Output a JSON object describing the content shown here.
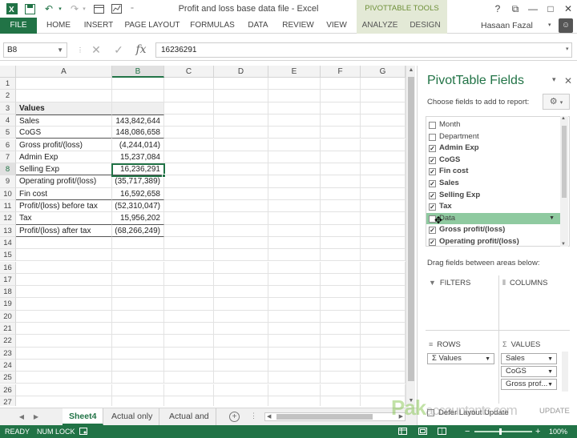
{
  "window": {
    "title": "Profit and loss base data file - Excel",
    "context_tab_group": "PIVOTTABLE TOOLS",
    "controls": [
      "?",
      "⧉",
      "—",
      "□",
      "✕"
    ]
  },
  "ribbon": {
    "tabs": [
      "FILE",
      "HOME",
      "INSERT",
      "PAGE LAYOUT",
      "FORMULAS",
      "DATA",
      "REVIEW",
      "VIEW",
      "ANALYZE",
      "DESIGN"
    ],
    "user": "Hasaan Fazal"
  },
  "formula_bar": {
    "name_box": "B8",
    "formula": "16236291",
    "fx": "fx"
  },
  "grid": {
    "columns": [
      "A",
      "B",
      "C",
      "D",
      "E",
      "F",
      "G"
    ],
    "selected_column": "B",
    "selected_row": 8,
    "rows": [
      {
        "n": "1",
        "a": "",
        "b": ""
      },
      {
        "n": "2",
        "a": "",
        "b": ""
      },
      {
        "n": "3",
        "a": "Values",
        "b": ""
      },
      {
        "n": "4",
        "a": "Sales",
        "b": "143,842,644"
      },
      {
        "n": "5",
        "a": "CoGS",
        "b": "148,086,658"
      },
      {
        "n": "6",
        "a": "Gross profit/(loss)",
        "b": "(4,244,014)"
      },
      {
        "n": "7",
        "a": "Admin Exp",
        "b": "15,237,084"
      },
      {
        "n": "8",
        "a": "Selling Exp",
        "b": "16,236,291"
      },
      {
        "n": "9",
        "a": "Operating profit/(loss)",
        "b": "(35,717,389)"
      },
      {
        "n": "10",
        "a": "Fin cost",
        "b": "16,592,658"
      },
      {
        "n": "11",
        "a": "Profit/(loss) before tax",
        "b": "(52,310,047)"
      },
      {
        "n": "12",
        "a": "Tax",
        "b": "15,956,202"
      },
      {
        "n": "13",
        "a": "Profit/(loss) after tax",
        "b": "(68,266,249)"
      },
      {
        "n": "14",
        "a": "",
        "b": ""
      },
      {
        "n": "15",
        "a": "",
        "b": ""
      },
      {
        "n": "16",
        "a": "",
        "b": ""
      },
      {
        "n": "17",
        "a": "",
        "b": ""
      },
      {
        "n": "18",
        "a": "",
        "b": ""
      },
      {
        "n": "19",
        "a": "",
        "b": ""
      },
      {
        "n": "20",
        "a": "",
        "b": ""
      },
      {
        "n": "21",
        "a": "",
        "b": ""
      },
      {
        "n": "22",
        "a": "",
        "b": ""
      },
      {
        "n": "23",
        "a": "",
        "b": ""
      },
      {
        "n": "24",
        "a": "",
        "b": ""
      },
      {
        "n": "25",
        "a": "",
        "b": ""
      },
      {
        "n": "26",
        "a": "",
        "b": ""
      },
      {
        "n": "27",
        "a": "",
        "b": ""
      }
    ]
  },
  "sheets": {
    "tabs": [
      "Sheet4",
      "Actual only",
      "Actual and"
    ],
    "active": "Sheet4",
    "add": "+"
  },
  "pivot_pane": {
    "title": "PivotTable Fields",
    "choose_label": "Choose fields to add to report:",
    "fields": [
      {
        "label": "Month",
        "checked": false
      },
      {
        "label": "Department",
        "checked": false
      },
      {
        "label": "Admin Exp",
        "checked": true
      },
      {
        "label": "CoGS",
        "checked": true
      },
      {
        "label": "Fin cost",
        "checked": true
      },
      {
        "label": "Sales",
        "checked": true
      },
      {
        "label": "Selling Exp",
        "checked": true
      },
      {
        "label": "Tax",
        "checked": true
      },
      {
        "label": "Data",
        "checked": false,
        "dragging": true
      },
      {
        "label": "Gross profit/(loss)",
        "checked": true
      },
      {
        "label": "Operating profit/(loss)",
        "checked": true
      }
    ],
    "drag_label": "Drag fields between areas below:",
    "areas": {
      "filters": "FILTERS",
      "columns": "COLUMNS",
      "rows": "ROWS",
      "values": "VALUES"
    },
    "rows_items": [
      "Σ Values"
    ],
    "values_items": [
      "Sales",
      "CoGS",
      "Gross prof..."
    ],
    "defer_label": "Defer Layout Update",
    "update_button": "UPDATE"
  },
  "watermark": {
    "brand": "Pak",
    "rest": "accountants.com"
  },
  "status_bar": {
    "mode": "READY",
    "num_lock": "NUM LOCK",
    "zoom": "100%"
  },
  "colors": {
    "accent": "#217346",
    "context_tab": "#e3e9d6",
    "drag_highlight": "#8fcaa0"
  }
}
